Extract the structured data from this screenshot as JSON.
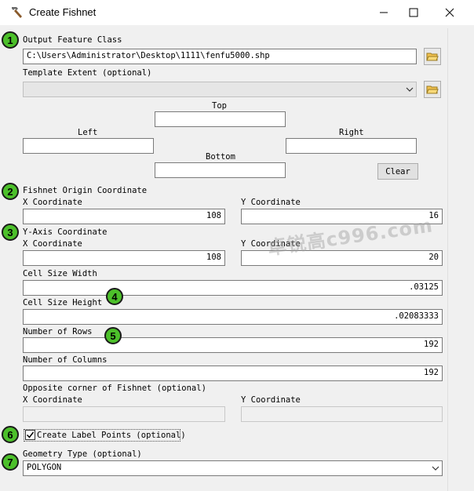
{
  "window": {
    "title": "Create Fishnet"
  },
  "output_feature_class": {
    "label": "Output Feature Class",
    "value": "C:\\Users\\Administrator\\Desktop\\1111\\fenfu5000.shp"
  },
  "template_extent": {
    "label": "Template Extent (optional)",
    "value": "",
    "top_label": "Top",
    "left_label": "Left",
    "right_label": "Right",
    "bottom_label": "Bottom",
    "clear_label": "Clear"
  },
  "origin": {
    "label": "Fishnet Origin Coordinate",
    "x_label": "X Coordinate",
    "x_value": "108",
    "y_label": "Y Coordinate",
    "y_value": "16"
  },
  "yaxis": {
    "label": "Y-Axis Coordinate",
    "x_label": "X Coordinate",
    "x_value": "108",
    "y_label": "Y Coordinate",
    "y_value": "20"
  },
  "cell_width": {
    "label": "Cell Size Width",
    "value": ".03125"
  },
  "cell_height": {
    "label": "Cell Size Height",
    "value": ".02083333"
  },
  "rows": {
    "label": "Number of Rows",
    "value": "192"
  },
  "columns": {
    "label": "Number of Columns",
    "value": "192"
  },
  "opposite": {
    "label": "Opposite corner of Fishnet (optional)",
    "x_label": "X Coordinate",
    "y_label": "Y Coordinate"
  },
  "label_points": {
    "label": "Create Label Points (optional)",
    "checked": true
  },
  "geometry": {
    "label": "Geometry Type (optional)",
    "value": "POLYGON"
  },
  "badges": [
    "1",
    "2",
    "3",
    "4",
    "5",
    "6",
    "7"
  ],
  "watermark": "卓锐高c996.com",
  "colors": {
    "badge": "#4cc02a",
    "dialog_bg": "#f0f0f0"
  }
}
